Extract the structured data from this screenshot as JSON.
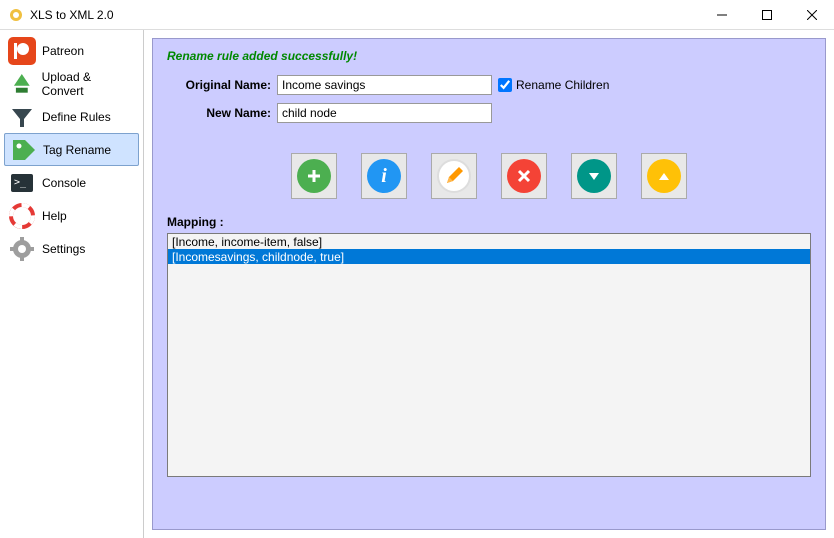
{
  "window": {
    "title": "XLS to XML 2.0"
  },
  "sidebar": {
    "items": [
      {
        "label": "Patreon"
      },
      {
        "label": "Upload & Convert"
      },
      {
        "label": "Define Rules"
      },
      {
        "label": "Tag Rename"
      },
      {
        "label": "Console"
      },
      {
        "label": "Help"
      },
      {
        "label": "Settings"
      }
    ]
  },
  "main": {
    "status_message": "Rename rule added successfully!",
    "labels": {
      "original_name": "Original Name:",
      "new_name": "New Name:",
      "rename_children": "Rename Children",
      "mapping": "Mapping :"
    },
    "fields": {
      "original_name": "Income savings",
      "new_name": "child node",
      "rename_children_checked": true
    },
    "icons": {
      "add": "add",
      "info": "info",
      "edit": "edit",
      "delete": "delete",
      "down": "down",
      "up": "up"
    },
    "mapping_rows": [
      {
        "text": "[Income, income-item, false]",
        "selected": false
      },
      {
        "text": "[Incomesavings, childnode, true]",
        "selected": true
      }
    ]
  }
}
